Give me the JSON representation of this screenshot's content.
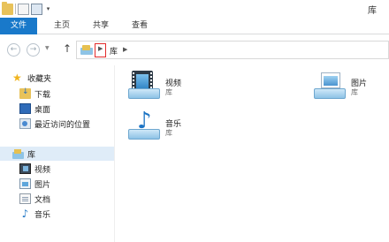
{
  "window": {
    "title": "库"
  },
  "ribbon": {
    "tabs": [
      {
        "label": "文件"
      },
      {
        "label": "主页"
      },
      {
        "label": "共享"
      },
      {
        "label": "查看"
      }
    ]
  },
  "address": {
    "crumbs": [
      "库"
    ]
  },
  "nav": {
    "favorites": {
      "label": "收藏夹",
      "icon": "star-icon"
    },
    "favorite_items": [
      {
        "label": "下载",
        "icon": "downloads-icon"
      },
      {
        "label": "桌面",
        "icon": "desktop-icon"
      },
      {
        "label": "最近访问的位置",
        "icon": "recent-places-icon"
      }
    ],
    "libraries": {
      "label": "库",
      "icon": "libraries-icon"
    },
    "library_items": [
      {
        "label": "视频",
        "icon": "videos-icon"
      },
      {
        "label": "图片",
        "icon": "pictures-icon"
      },
      {
        "label": "文档",
        "icon": "documents-icon"
      },
      {
        "label": "音乐",
        "icon": "music-icon"
      }
    ]
  },
  "content": {
    "tiles": [
      {
        "name": "视频",
        "subtitle": "库",
        "icon": "videos-library-icon"
      },
      {
        "name": "图片",
        "subtitle": "库",
        "icon": "pictures-library-icon"
      },
      {
        "name": "音乐",
        "subtitle": "库",
        "icon": "music-library-icon"
      }
    ]
  },
  "colors": {
    "file_tab": "#1979ca",
    "selected_nav": "#dfecf8",
    "highlight_box": "#e32b2b"
  }
}
